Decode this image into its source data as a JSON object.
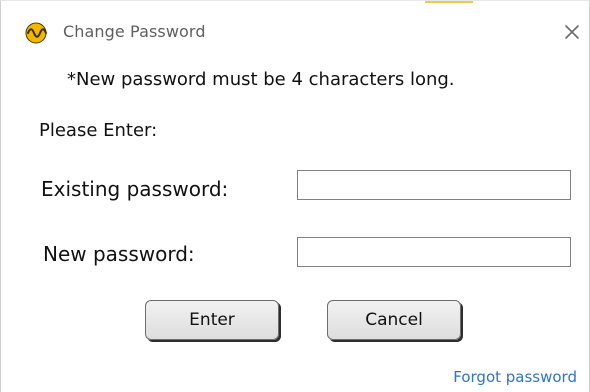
{
  "window": {
    "title": "Change Password"
  },
  "dialog": {
    "note": "*New password must be 4 characters long.",
    "instruction": "Please Enter:",
    "existing_password_label": "Existing password:",
    "new_password_label": "New password:",
    "existing_password_value": "",
    "new_password_value": "",
    "enter_label": "Enter",
    "cancel_label": "Cancel",
    "forgot_label": "Forgot password"
  },
  "icons": {
    "app": "waveform-app-icon",
    "close": "close-icon"
  },
  "colors": {
    "accent": "#f2c94c",
    "link": "#2f74c5"
  }
}
